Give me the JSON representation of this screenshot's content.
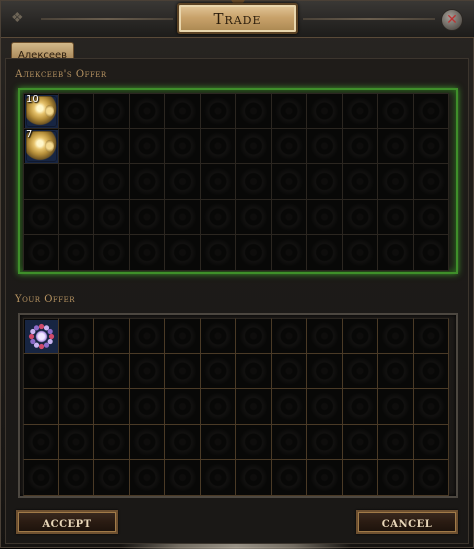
{
  "window": {
    "title": "Trade"
  },
  "tab": {
    "label": "Алексеев"
  },
  "their_offer": {
    "label": "Алексеев's Offer",
    "columns": 12,
    "rows": 5,
    "items": [
      {
        "name": "orb",
        "stack": "10",
        "row": 0,
        "col": 0
      },
      {
        "name": "orb",
        "stack": "7",
        "row": 1,
        "col": 0
      }
    ]
  },
  "your_offer": {
    "label": "Your Offer",
    "columns": 12,
    "rows": 5,
    "items": [
      {
        "name": "ring",
        "row": 0,
        "col": 0
      }
    ]
  },
  "buttons": {
    "accept": "Accept",
    "cancel": "Cancel"
  },
  "colors": {
    "their_frame": "#3f8f2a",
    "title_plate": "#c9a36b",
    "label_text": "#b89563"
  },
  "icons": {
    "close": "close-icon",
    "corner": "corner-ornament-icon"
  }
}
